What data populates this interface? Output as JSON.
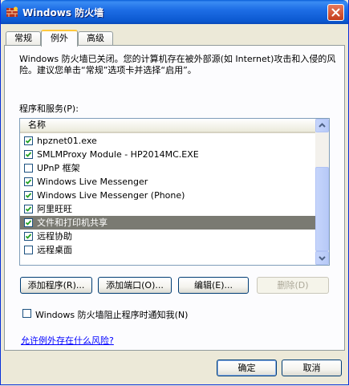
{
  "window": {
    "title": "Windows 防火墙",
    "accent": "#0a58d0",
    "close_color": "#c33c1b"
  },
  "tabs": [
    {
      "label": "常规",
      "active": false
    },
    {
      "label": "例外",
      "active": true
    },
    {
      "label": "高级",
      "active": false
    }
  ],
  "exceptions": {
    "description": "Windows 防火墙已关闭。您的计算机存在被外部源(如 Internet)攻击和入侵的风险。建议您单击“常规”选项卡并选择“启用”。",
    "list_label": "程序和服务(P):",
    "column_header": "名称",
    "items": [
      {
        "label": "hpznet01.exe",
        "checked": true,
        "selected": false
      },
      {
        "label": "SMLMProxy Module - HP2014MC.EXE",
        "checked": true,
        "selected": false
      },
      {
        "label": "UPnP 框架",
        "checked": false,
        "selected": false
      },
      {
        "label": "Windows Live Messenger",
        "checked": true,
        "selected": false
      },
      {
        "label": "Windows Live Messenger (Phone)",
        "checked": true,
        "selected": false
      },
      {
        "label": "阿里旺旺",
        "checked": true,
        "selected": false
      },
      {
        "label": "文件和打印机共享",
        "checked": true,
        "selected": true
      },
      {
        "label": "远程协助",
        "checked": true,
        "selected": false
      },
      {
        "label": "远程桌面",
        "checked": false,
        "selected": false
      }
    ],
    "buttons": {
      "add_program": "添加程序(R)...",
      "add_port": "添加端口(O)...",
      "edit": "编辑(E)...",
      "delete": "删除(D)"
    },
    "notify_label": "Windows 防火墙阻止程序时通知我(N)",
    "notify_checked": false,
    "risk_link": "允许例外存在什么风险?"
  },
  "dialog_buttons": {
    "ok": "确定",
    "cancel": "取消"
  }
}
